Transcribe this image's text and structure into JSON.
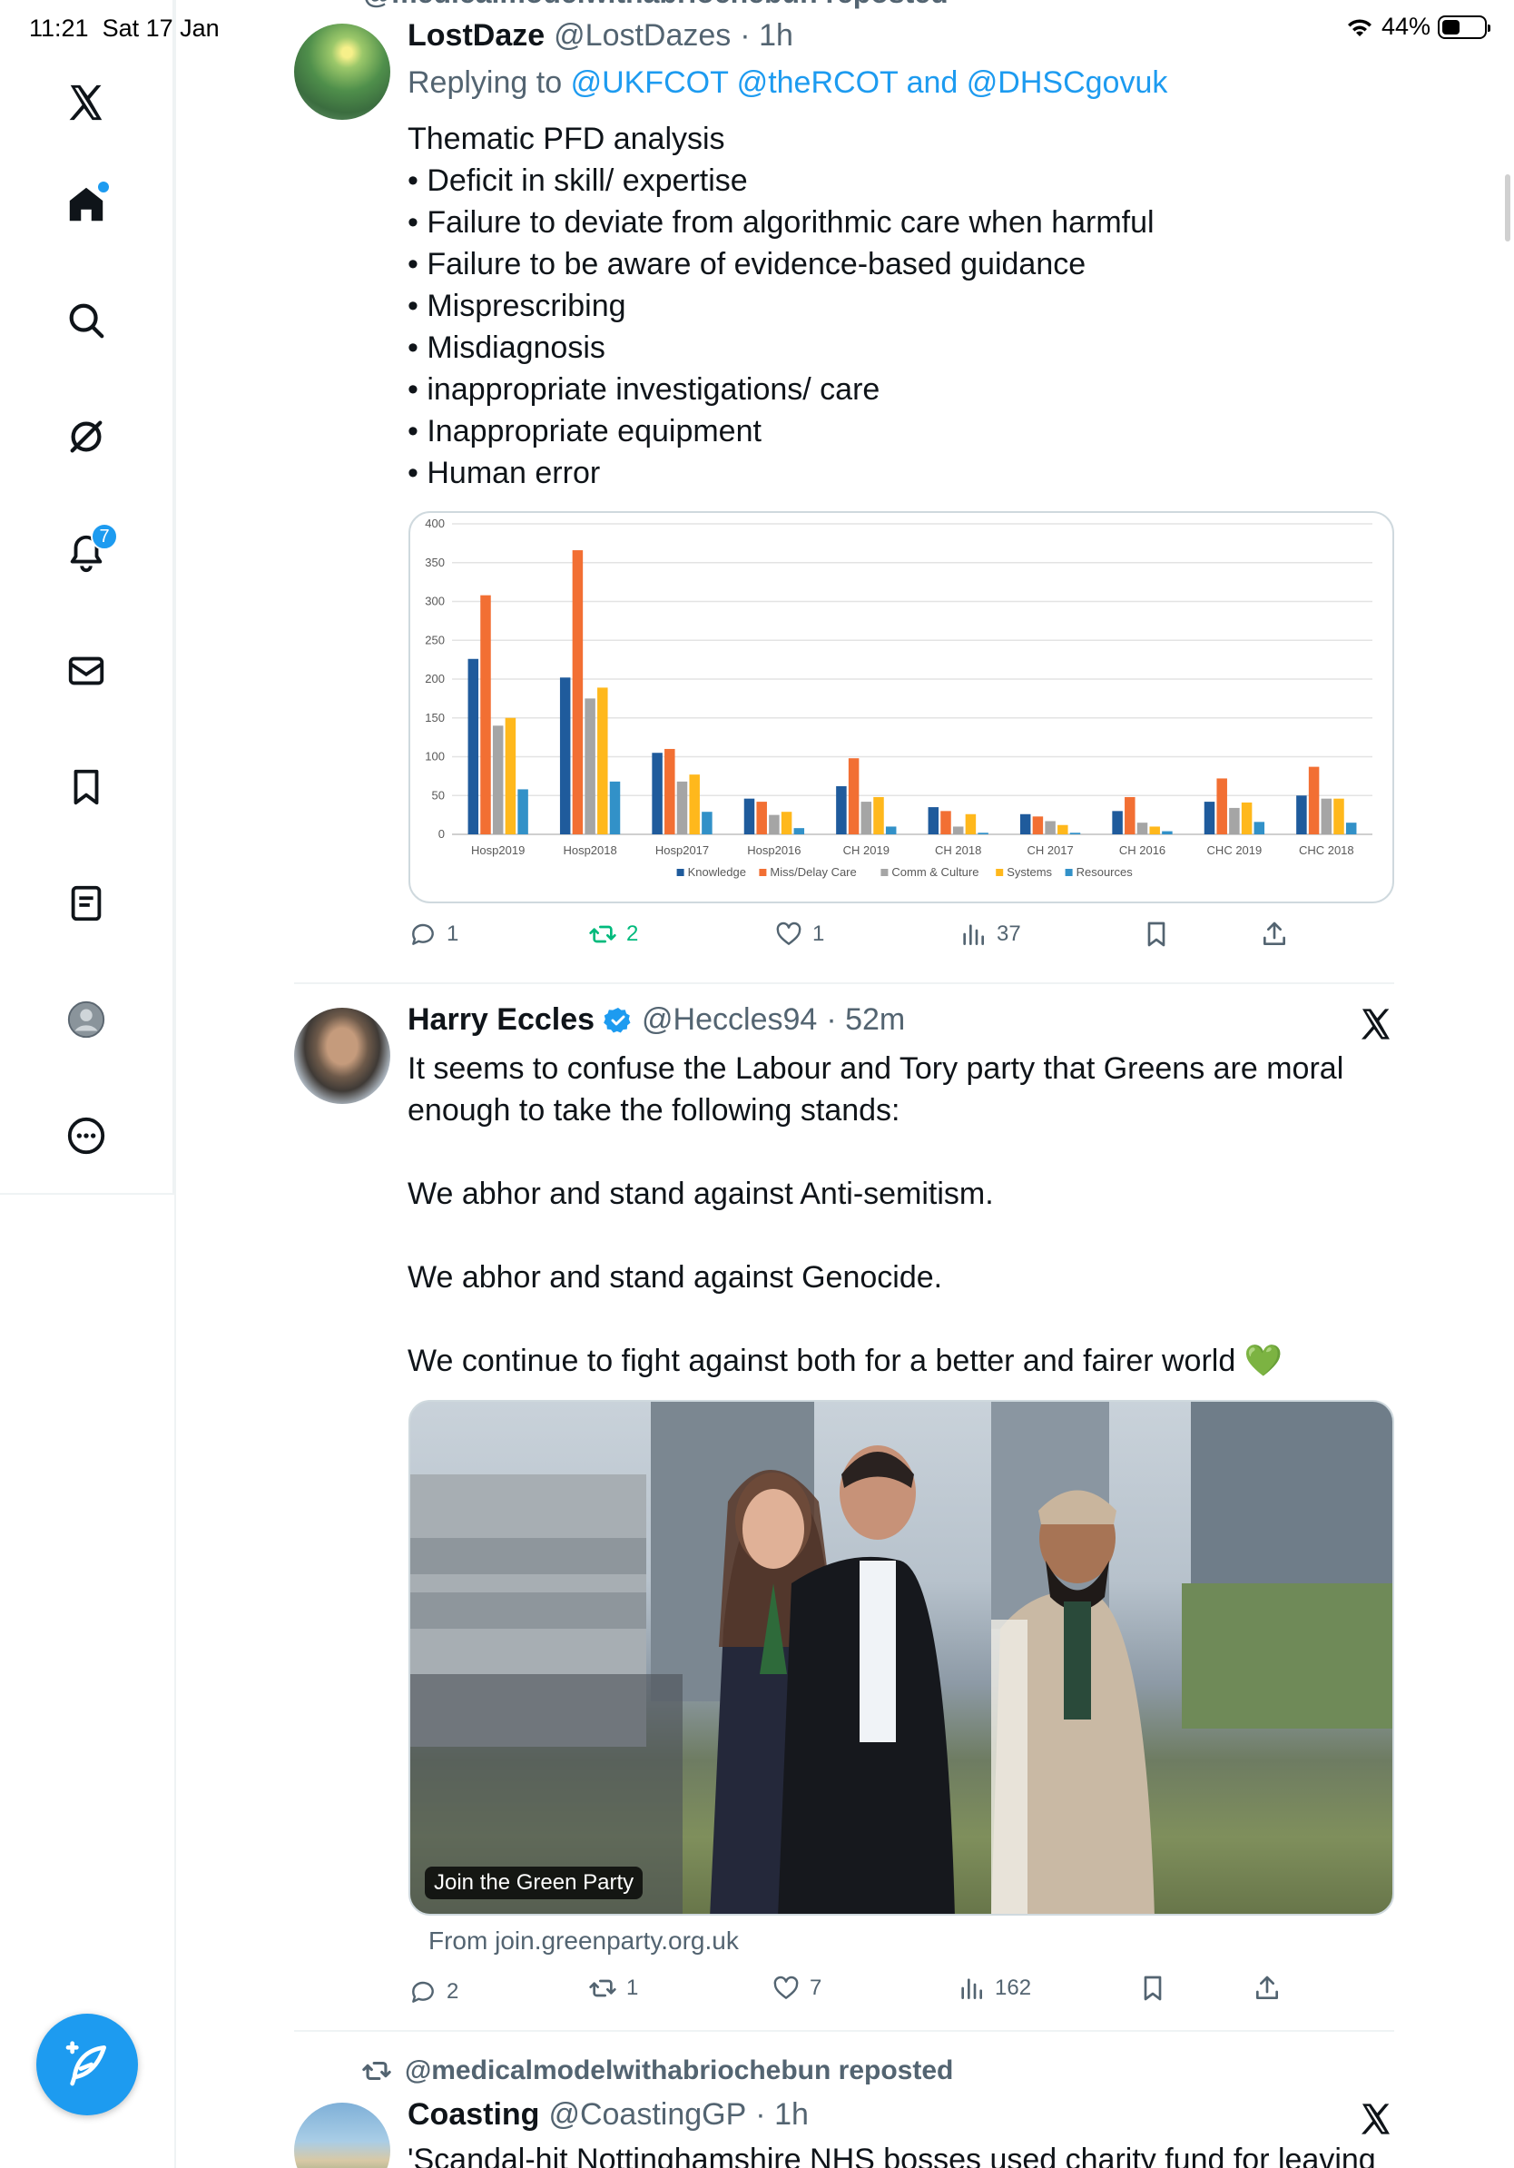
{
  "status_bar": {
    "time": "11:21",
    "date": "Sat 17 Jan",
    "battery": "44%",
    "battery_level": 0.44
  },
  "sidebar": {
    "notifications_badge": "7",
    "items": [
      "x-logo",
      "home",
      "search",
      "grok",
      "notifications",
      "messages",
      "bookmarks",
      "lists",
      "profile",
      "more"
    ]
  },
  "top_repost": "@medicalmodelwithabriochebun reposted",
  "tweet1": {
    "name": "LostDaze",
    "handle": "@LostDazes",
    "time": "· 1h",
    "replying_prefix": "Replying to",
    "replying_links": "@UKFCOT @theRCOT and @DHSCgovuk",
    "text": "Thematic PFD analysis\n• Deficit in skill/ expertise\n• Failure to deviate from algorithmic care when harmful\n• Failure to be aware of evidence-based guidance\n• Misprescribing\n• Misdiagnosis\n• inappropriate investigations/ care\n• Inappropriate equipment\n• Human error",
    "replies": "1",
    "reposts": "2",
    "likes": "1",
    "views": "37"
  },
  "chart_data": {
    "type": "bar",
    "categories": [
      "Hosp2019",
      "Hosp2018",
      "Hosp2017",
      "Hosp2016",
      "CH 2019",
      "CH 2018",
      "CH 2017",
      "CH 2016",
      "CHC 2019",
      "CHC 2018"
    ],
    "series": [
      {
        "name": "Knowledge",
        "color": "#1f5b9c",
        "values": [
          226,
          202,
          105,
          46,
          62,
          35,
          26,
          30,
          42,
          50
        ]
      },
      {
        "name": "Miss/Delay Care",
        "color": "#f26f33",
        "values": [
          308,
          366,
          110,
          42,
          98,
          30,
          23,
          48,
          72,
          87
        ]
      },
      {
        "name": "Comm & Culture",
        "color": "#a5a5a5",
        "values": [
          140,
          175,
          68,
          25,
          42,
          10,
          17,
          15,
          34,
          46
        ]
      },
      {
        "name": "Systems",
        "color": "#ffb81c",
        "values": [
          150,
          189,
          77,
          29,
          48,
          26,
          12,
          10,
          41,
          46
        ]
      },
      {
        "name": "Resources",
        "color": "#3291c8",
        "values": [
          58,
          68,
          29,
          8,
          10,
          2,
          2,
          4,
          16,
          15
        ]
      }
    ],
    "yticks": [
      "0",
      "50",
      "100",
      "150",
      "200",
      "250",
      "300",
      "350",
      "400"
    ],
    "ylim": [
      0,
      400
    ],
    "grid": true,
    "legend": "bottom"
  },
  "tweet2": {
    "name": "Harry Eccles",
    "handle": "@Heccles94",
    "time": "· 52m",
    "text": "It seems to confuse the Labour and Tory party that Greens are moral\nenough to take the following stands:\n\nWe abhor and stand against Anti-semitism.\n\nWe abhor and stand against Genocide.\n\nWe continue to fight against both for a better and fairer world 💚",
    "media_label": "Join the Green Party",
    "from": "From join.greenparty.org.uk",
    "replies": "2",
    "reposts": "1",
    "likes": "7",
    "views": "162"
  },
  "tweet3": {
    "repost_line": "@medicalmodelwithabriochebun reposted",
    "name": "Coasting",
    "handle": "@CoastingGP",
    "time": "· 1h",
    "text": "'Scandal-hit Nottinghamshire NHS bosses used charity fund for leaving"
  }
}
